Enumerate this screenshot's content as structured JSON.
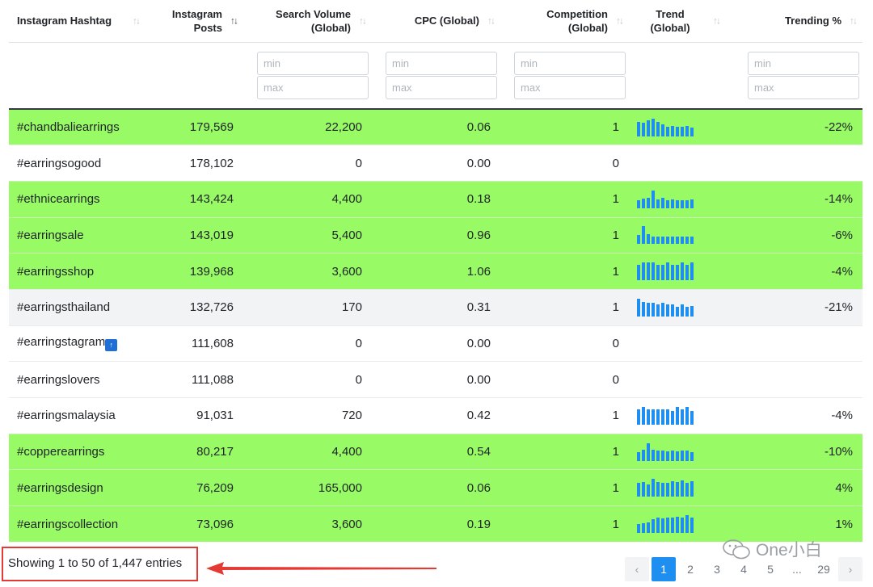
{
  "headers": [
    {
      "label": "Instagram Hashtag",
      "align": "left",
      "sort": "none"
    },
    {
      "label": "Instagram Posts",
      "align": "right",
      "sort": "active"
    },
    {
      "label": "Search Volume (Global)",
      "align": "right",
      "sort": "none"
    },
    {
      "label": "CPC (Global)",
      "align": "right",
      "sort": "none"
    },
    {
      "label": "Competition (Global)",
      "align": "right",
      "sort": "none"
    },
    {
      "label": "Trend (Global)",
      "align": "center",
      "sort": "none"
    },
    {
      "label": "Trending %",
      "align": "right",
      "sort": "none"
    }
  ],
  "filters": {
    "min_placeholder": "min",
    "max_placeholder": "max"
  },
  "rows": [
    {
      "tag": "#chandbaliearrings",
      "posts": "179,569",
      "volume": "22,200",
      "cpc": "0.06",
      "competition": "1",
      "trending": "-22%",
      "style": "green",
      "trend": [
        0.8,
        0.75,
        0.9,
        1.0,
        0.8,
        0.7,
        0.55,
        0.6,
        0.55,
        0.55,
        0.6,
        0.5
      ]
    },
    {
      "tag": "#earringsogood",
      "posts": "178,102",
      "volume": "0",
      "cpc": "0.00",
      "competition": "0",
      "trending": "",
      "style": "white",
      "trend": []
    },
    {
      "tag": "#ethnicearrings",
      "posts": "143,424",
      "volume": "4,400",
      "cpc": "0.18",
      "competition": "1",
      "trending": "-14%",
      "style": "green",
      "trend": [
        0.45,
        0.55,
        0.6,
        1.0,
        0.5,
        0.6,
        0.45,
        0.5,
        0.45,
        0.45,
        0.45,
        0.5
      ]
    },
    {
      "tag": "#earringsale",
      "posts": "143,019",
      "volume": "5,400",
      "cpc": "0.96",
      "competition": "1",
      "trending": "-6%",
      "style": "green",
      "trend": [
        0.5,
        1.0,
        0.55,
        0.4,
        0.4,
        0.4,
        0.4,
        0.4,
        0.4,
        0.4,
        0.4,
        0.4
      ]
    },
    {
      "tag": "#earringsshop",
      "posts": "139,968",
      "volume": "3,600",
      "cpc": "1.06",
      "competition": "1",
      "trending": "-4%",
      "style": "green",
      "trend": [
        0.85,
        1.0,
        1.0,
        1.0,
        0.85,
        0.85,
        1.0,
        0.85,
        0.85,
        1.0,
        0.85,
        1.0
      ]
    },
    {
      "tag": "#earringsthailand",
      "posts": "132,726",
      "volume": "170",
      "cpc": "0.31",
      "competition": "1",
      "trending": "-21%",
      "style": "grey",
      "trend": [
        1.0,
        0.8,
        0.75,
        0.75,
        0.7,
        0.75,
        0.7,
        0.7,
        0.55,
        0.7,
        0.55,
        0.6
      ]
    },
    {
      "tag": "#earringstagram",
      "posts": "111,608",
      "volume": "0",
      "cpc": "0.00",
      "competition": "0",
      "trending": "",
      "style": "white",
      "trend": [],
      "icon": "up-arrow-icon"
    },
    {
      "tag": "#earringslovers",
      "posts": "111,088",
      "volume": "0",
      "cpc": "0.00",
      "competition": "0",
      "trending": "",
      "style": "white",
      "trend": []
    },
    {
      "tag": "#earringsmalaysia",
      "posts": "91,031",
      "volume": "720",
      "cpc": "0.42",
      "competition": "1",
      "trending": "-4%",
      "style": "white",
      "trend": [
        0.85,
        1.0,
        0.85,
        0.85,
        0.85,
        0.85,
        0.85,
        0.75,
        1.0,
        0.85,
        1.0,
        0.75
      ]
    },
    {
      "tag": "#copperearrings",
      "posts": "80,217",
      "volume": "4,400",
      "cpc": "0.54",
      "competition": "1",
      "trending": "-10%",
      "style": "green",
      "trend": [
        0.5,
        0.65,
        1.0,
        0.65,
        0.6,
        0.6,
        0.55,
        0.6,
        0.55,
        0.6,
        0.6,
        0.5
      ]
    },
    {
      "tag": "#earringsdesign",
      "posts": "76,209",
      "volume": "165,000",
      "cpc": "0.06",
      "competition": "1",
      "trending": "4%",
      "style": "green",
      "trend": [
        0.75,
        0.8,
        0.7,
        1.0,
        0.8,
        0.75,
        0.75,
        0.85,
        0.8,
        0.9,
        0.75,
        0.85
      ]
    },
    {
      "tag": "#earringscollection",
      "posts": "73,096",
      "volume": "3,600",
      "cpc": "0.19",
      "competition": "1",
      "trending": "1%",
      "style": "green",
      "trend": [
        0.5,
        0.55,
        0.6,
        0.75,
        0.85,
        0.8,
        0.85,
        0.85,
        0.9,
        0.85,
        1.0,
        0.85
      ]
    }
  ],
  "footer": {
    "info": "Showing 1 to 50 of 1,447 entries"
  },
  "pagination": {
    "prev": "‹",
    "pages": [
      "1",
      "2",
      "3",
      "4",
      "5",
      "...",
      "29"
    ],
    "active": "1",
    "next": "›"
  },
  "watermark": {
    "text": "One小白"
  },
  "colors": {
    "row_green": "#98fb65",
    "accent": "#1e8ff0",
    "annotation": "#e53935"
  }
}
